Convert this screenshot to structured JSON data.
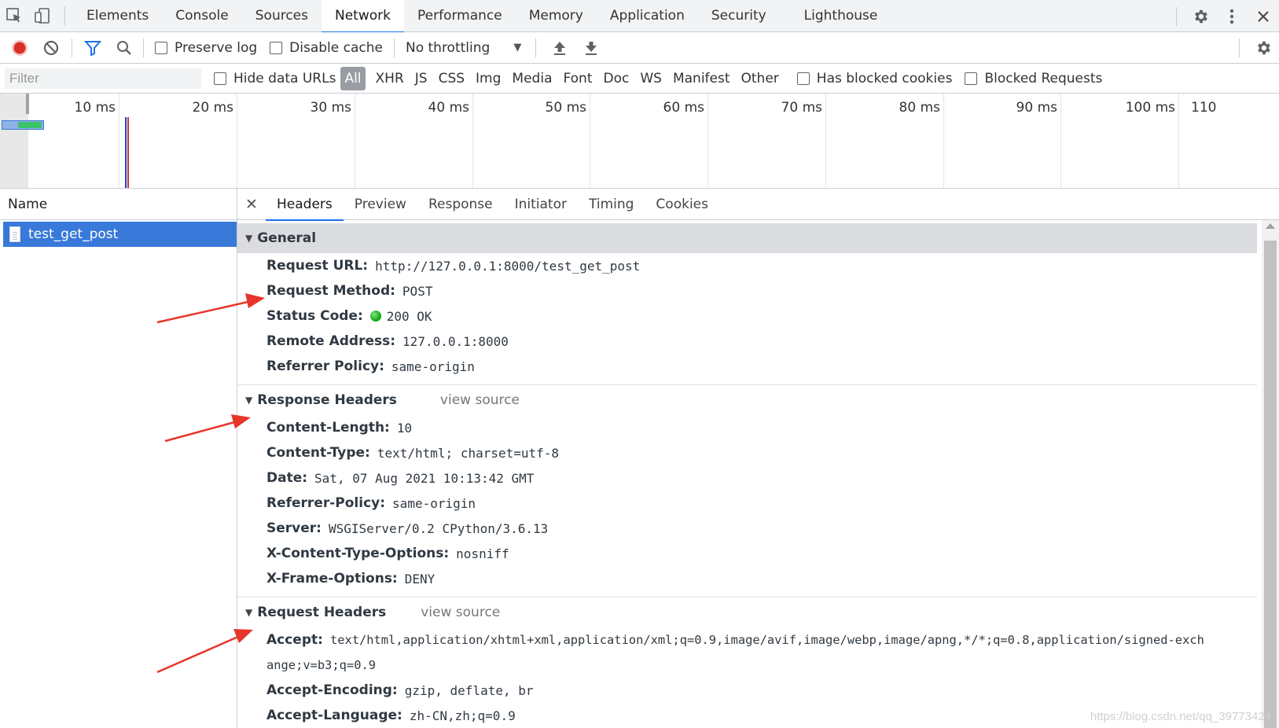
{
  "panel_tabs": [
    "Elements",
    "Console",
    "Sources",
    "Network",
    "Performance",
    "Memory",
    "Application",
    "Security",
    "Lighthouse"
  ],
  "active_panel": "Network",
  "toolbar": {
    "preserve_log": "Preserve log",
    "disable_cache": "Disable cache",
    "throttling": "No throttling"
  },
  "filterbar": {
    "filter_placeholder": "Filter",
    "hide_data_urls": "Hide data URLs",
    "types": [
      "All",
      "XHR",
      "JS",
      "CSS",
      "Img",
      "Media",
      "Font",
      "Doc",
      "WS",
      "Manifest",
      "Other"
    ],
    "active_type": "All",
    "has_blocked_cookies": "Has blocked cookies",
    "blocked_requests": "Blocked Requests"
  },
  "overview": {
    "ticks": [
      "10 ms",
      "20 ms",
      "30 ms",
      "40 ms",
      "50 ms",
      "60 ms",
      "70 ms",
      "80 ms",
      "90 ms",
      "100 ms",
      "110"
    ]
  },
  "name_column": {
    "header": "Name",
    "requests": [
      "test_get_post"
    ]
  },
  "detail_tabs": [
    "Headers",
    "Preview",
    "Response",
    "Initiator",
    "Timing",
    "Cookies"
  ],
  "active_detail_tab": "Headers",
  "general": {
    "title": "General",
    "rows": [
      {
        "key": "Request URL:",
        "value": "http://127.0.0.1:8000/test_get_post"
      },
      {
        "key": "Request Method:",
        "value": "POST"
      },
      {
        "key": "Status Code:",
        "value": "200 OK"
      },
      {
        "key": "Remote Address:",
        "value": "127.0.0.1:8000"
      },
      {
        "key": "Referrer Policy:",
        "value": "same-origin"
      }
    ]
  },
  "response_headers": {
    "title": "Response Headers",
    "view_source": "view source",
    "rows": [
      {
        "key": "Content-Length:",
        "value": "10"
      },
      {
        "key": "Content-Type:",
        "value": "text/html; charset=utf-8"
      },
      {
        "key": "Date:",
        "value": "Sat, 07 Aug 2021 10:13:42 GMT"
      },
      {
        "key": "Referrer-Policy:",
        "value": "same-origin"
      },
      {
        "key": "Server:",
        "value": "WSGIServer/0.2 CPython/3.6.13"
      },
      {
        "key": "X-Content-Type-Options:",
        "value": "nosniff"
      },
      {
        "key": "X-Frame-Options:",
        "value": "DENY"
      }
    ]
  },
  "request_headers": {
    "title": "Request Headers",
    "view_source": "view source",
    "accept_key": "Accept:",
    "accept_value_line1": "text/html,application/xhtml+xml,application/xml;q=0.9,image/avif,image/webp,image/apng,*/*;q=0.8,application/signed-exch",
    "accept_value_line2": "ange;v=b3;q=0.9",
    "rows": [
      {
        "key": "Accept-Encoding:",
        "value": "gzip, deflate, br"
      },
      {
        "key": "Accept-Language:",
        "value": "zh-CN,zh;q=0.9"
      }
    ]
  },
  "watermark": "https://blog.csdn.net/qq_39773424",
  "colors": {
    "accent": "#1a73e8",
    "selected_row": "#3879d9",
    "record": "#d93025",
    "annotation_arrow": "#e8352b"
  }
}
